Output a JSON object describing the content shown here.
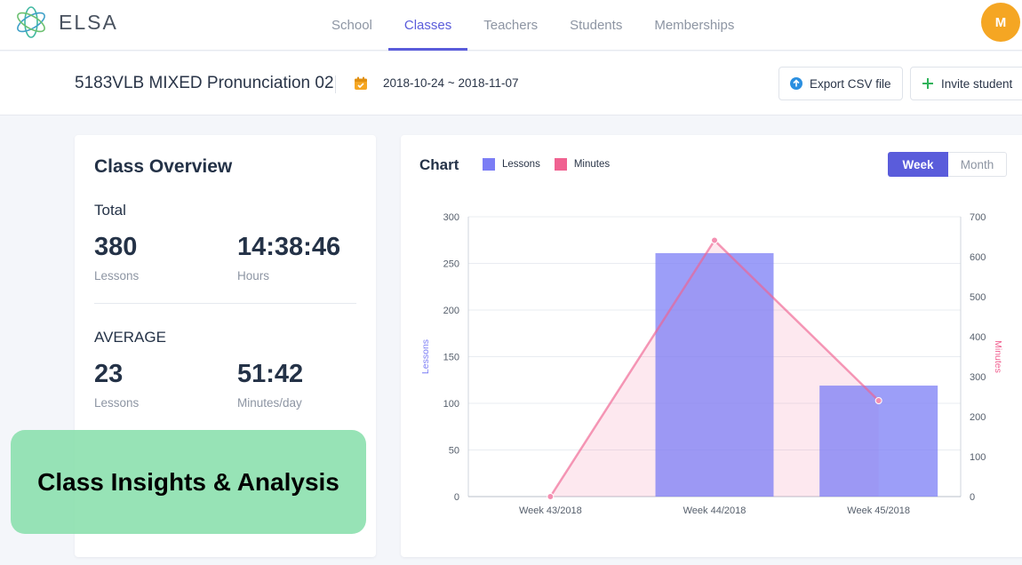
{
  "app": {
    "brand": "ELSA",
    "avatar_initial": "M"
  },
  "nav": {
    "items": [
      {
        "label": "School",
        "active": false
      },
      {
        "label": "Classes",
        "active": true
      },
      {
        "label": "Teachers",
        "active": false
      },
      {
        "label": "Students",
        "active": false
      },
      {
        "label": "Memberships",
        "active": false
      }
    ]
  },
  "subheader": {
    "class_name": "5183VLB MIXED Pronunciation 02",
    "date_range": "2018-10-24 ~ 2018-11-07",
    "export_label": "Export CSV file",
    "invite_label": "Invite student"
  },
  "overview": {
    "title": "Class Overview",
    "total_label": "Total",
    "total_lessons": "380",
    "total_lessons_label": "Lessons",
    "total_hours": "14:38:46",
    "total_hours_label": "Hours",
    "average_label": "AVERAGE",
    "avg_lessons": "23",
    "avg_lessons_label": "Lessons",
    "avg_minutes": "51:42",
    "avg_minutes_label": "Minutes/day"
  },
  "chart": {
    "title": "Chart",
    "toggle_week": "Week",
    "toggle_month": "Month"
  },
  "chart_data": {
    "type": "bar",
    "categories": [
      "Week 43/2018",
      "Week 44/2018",
      "Week 45/2018"
    ],
    "series": [
      {
        "name": "Lessons",
        "type": "bar",
        "axis": "left",
        "color": "#7b7df5",
        "values": [
          0,
          261,
          119
        ]
      },
      {
        "name": "Minutes",
        "type": "area-line",
        "axis": "right",
        "color": "#f06291",
        "values": [
          0,
          641,
          240
        ]
      }
    ],
    "ylabel": "Lessons",
    "y2label": "Minutes",
    "ylim": [
      0,
      300
    ],
    "y2lim": [
      0,
      700
    ],
    "yticks": [
      0,
      50,
      100,
      150,
      200,
      250,
      300
    ],
    "y2ticks": [
      0,
      100,
      200,
      300,
      400,
      500,
      600,
      700
    ],
    "legend": "top-left",
    "grid": true
  },
  "banner": {
    "text": "Class Insights & Analysis"
  },
  "colors": {
    "accent": "#5a5cdb",
    "avatar": "#f5a623",
    "lessons": "#7b7df5",
    "minutes": "#f06291",
    "banner": "#85dea9"
  }
}
